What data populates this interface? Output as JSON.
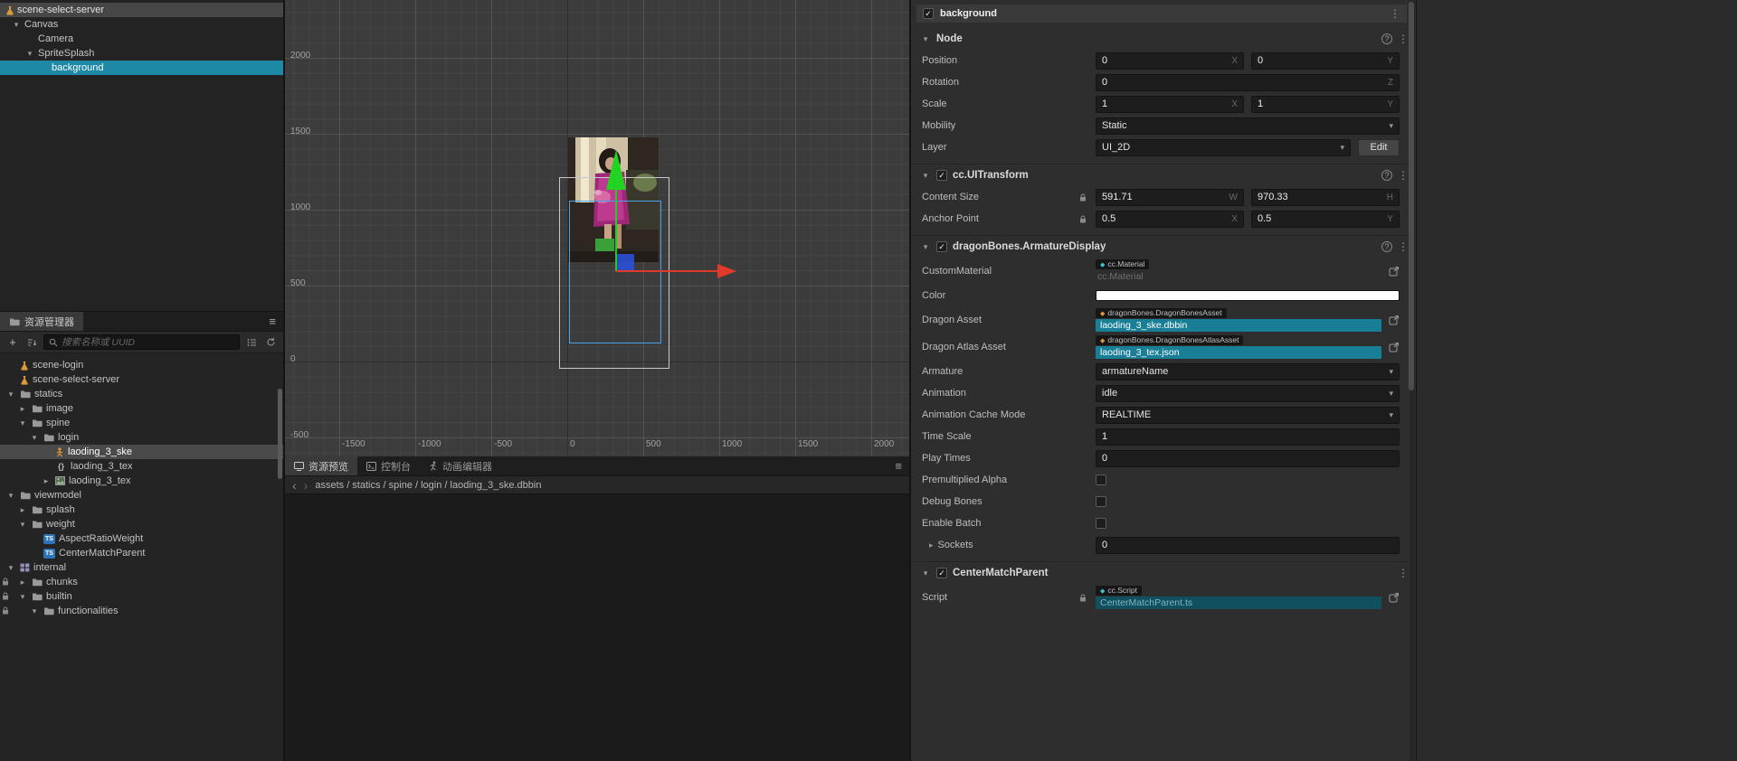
{
  "hierarchy": {
    "root": "scene-select-server",
    "nodes": [
      {
        "label": "Canvas"
      },
      {
        "label": "Camera"
      },
      {
        "label": "SpriteSplash"
      },
      {
        "label": "background"
      }
    ]
  },
  "assets": {
    "tab_label": "资源管理器",
    "search_placeholder": "搜索名称或 UUID",
    "badges": {
      "ts": "TS",
      "json": "{}"
    },
    "tree": [
      {
        "label": "scene-login"
      },
      {
        "label": "scene-select-server"
      },
      {
        "label": "statics"
      },
      {
        "label": "image"
      },
      {
        "label": "spine"
      },
      {
        "label": "login"
      },
      {
        "label": "laoding_3_ske"
      },
      {
        "label": "laoding_3_tex"
      },
      {
        "label": "laoding_3_tex"
      },
      {
        "label": "viewmodel"
      },
      {
        "label": "splash"
      },
      {
        "label": "weight"
      },
      {
        "label": "AspectRatioWeight"
      },
      {
        "label": "CenterMatchParent"
      },
      {
        "label": "internal"
      },
      {
        "label": "chunks"
      },
      {
        "label": "builtin"
      },
      {
        "label": "functionalities"
      }
    ]
  },
  "scene": {
    "y_axis_labels": [
      "2000",
      "1500",
      "1000",
      "500",
      "0",
      "-500"
    ],
    "x_axis_labels": [
      "-1500",
      "-1000",
      "-500",
      "0",
      "500",
      "1000",
      "1500",
      "2000"
    ]
  },
  "preview": {
    "tabs": [
      {
        "label": "资源预览"
      },
      {
        "label": "控制台"
      },
      {
        "label": "动画编辑器"
      }
    ],
    "breadcrumb": "assets / statics / spine / login / laoding_3_ske.dbbin"
  },
  "inspector": {
    "node_name": "background",
    "suffix": {
      "x": "X",
      "y": "Y",
      "z": "Z",
      "w": "W",
      "h": "H"
    },
    "node": {
      "title": "Node",
      "position": {
        "label": "Position",
        "x": "0",
        "y": "0"
      },
      "rotation": {
        "label": "Rotation",
        "value": "0"
      },
      "scale": {
        "label": "Scale",
        "x": "1",
        "y": "1"
      },
      "mobility": {
        "label": "Mobility",
        "value": "Static"
      },
      "layer": {
        "label": "Layer",
        "value": "UI_2D",
        "edit_button": "Edit"
      }
    },
    "uitransform": {
      "title": "cc.UITransform",
      "content_size": {
        "label": "Content Size",
        "w": "591.71",
        "h": "970.33"
      },
      "anchor_point": {
        "label": "Anchor Point",
        "x": "0.5",
        "y": "0.5"
      }
    },
    "armature_display": {
      "title": "dragonBones.ArmatureDisplay",
      "custom_material": {
        "label": "CustomMaterial",
        "type": "cc.Material",
        "placeholder": "cc.Material"
      },
      "color": {
        "label": "Color",
        "value": "#FFFFFF"
      },
      "dragon_asset": {
        "label": "Dragon Asset",
        "type": "dragonBones.DragonBonesAsset",
        "value": "laoding_3_ske.dbbin"
      },
      "dragon_atlas_asset": {
        "label": "Dragon Atlas Asset",
        "type": "dragonBones.DragonBonesAtlasAsset",
        "value": "laoding_3_tex.json"
      },
      "armature": {
        "label": "Armature",
        "value": "armatureName"
      },
      "animation": {
        "label": "Animation",
        "value": "idle"
      },
      "animation_cache_mode": {
        "label": "Animation Cache Mode",
        "value": "REALTIME"
      },
      "time_scale": {
        "label": "Time Scale",
        "value": "1"
      },
      "play_times": {
        "label": "Play Times",
        "value": "0"
      },
      "premultiplied_alpha": {
        "label": "Premultiplied Alpha"
      },
      "debug_bones": {
        "label": "Debug Bones"
      },
      "enable_batch": {
        "label": "Enable Batch"
      },
      "sockets": {
        "label": "Sockets",
        "value": "0"
      }
    },
    "center_match_parent": {
      "title": "CenterMatchParent",
      "script": {
        "label": "Script",
        "type": "cc.Script",
        "value": "CenterMatchParent.ts"
      }
    }
  }
}
